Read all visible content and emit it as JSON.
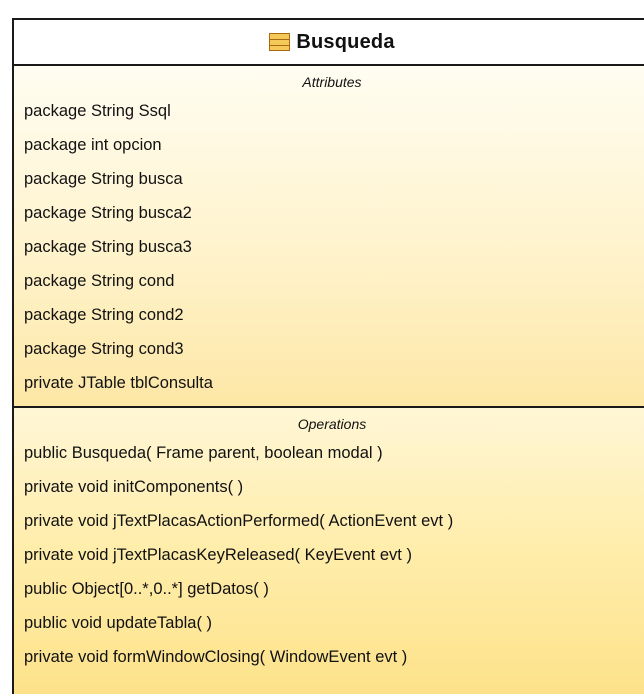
{
  "class": {
    "name": "Busqueda",
    "icon": "class-icon"
  },
  "attributes": {
    "title": "Attributes",
    "items": [
      "package String Ssql",
      "package int opcion",
      "package String busca",
      "package String busca2",
      "package String busca3",
      "package String cond",
      "package String cond2",
      "package String cond3",
      "private JTable tblConsulta"
    ]
  },
  "operations": {
    "title": "Operations",
    "items": [
      "public Busqueda( Frame parent, boolean modal )",
      "private void  initComponents( )",
      "private void  jTextPlacasActionPerformed( ActionEvent evt )",
      "private void  jTextPlacasKeyReleased( KeyEvent evt )",
      "public Object[0..*,0..*]  getDatos( )",
      "public void  updateTabla( )",
      "private void  formWindowClosing( WindowEvent evt )"
    ]
  },
  "colors": {
    "border": "#1a1a1a",
    "icon_fill": "#f5c85a",
    "compartment_light": "#fffdf2",
    "compartment_dark": "#fde28a"
  }
}
